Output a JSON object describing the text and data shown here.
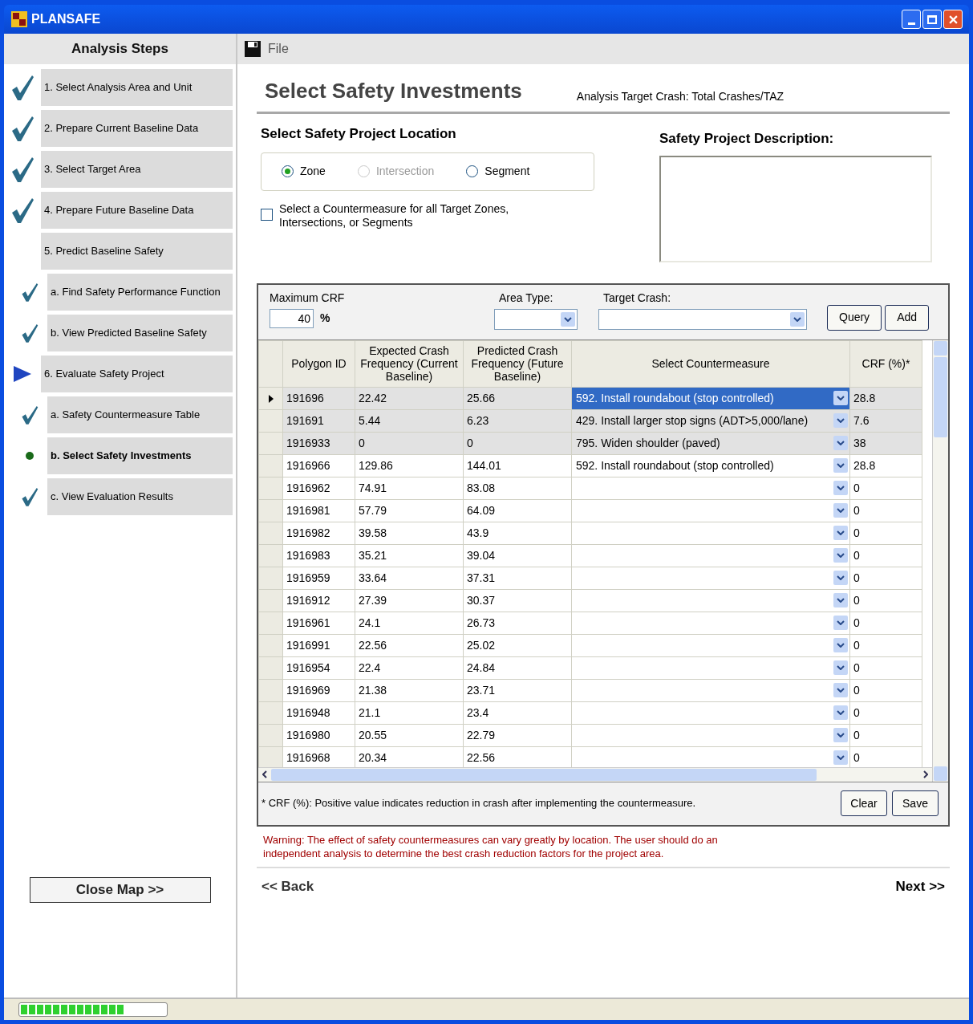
{
  "window": {
    "title": "PLANSAFE"
  },
  "sidebar": {
    "title": "Analysis Steps",
    "steps": [
      {
        "label": "1. Select Analysis Area and Unit",
        "kind": "done"
      },
      {
        "label": "2. Prepare Current Baseline Data",
        "kind": "done"
      },
      {
        "label": "3. Select Target Area",
        "kind": "done"
      },
      {
        "label": "4. Prepare Future Baseline Data",
        "kind": "done"
      },
      {
        "label": "5. Predict Baseline Safety",
        "kind": "plain",
        "children": [
          {
            "label": "a. Find Safety Performance Function",
            "kind": "done"
          },
          {
            "label": "b. View Predicted Baseline Safety",
            "kind": "done"
          }
        ]
      },
      {
        "label": "6. Evaluate Safety Project",
        "kind": "current",
        "children": [
          {
            "label": "a. Safety Countermeasure Table",
            "kind": "done"
          },
          {
            "label": "b. Select Safety Investments",
            "kind": "active"
          },
          {
            "label": "c. View Evaluation Results",
            "kind": "done"
          }
        ]
      }
    ],
    "close_button": "Close Map >>"
  },
  "menu": {
    "file": "File"
  },
  "page": {
    "title": "Select Safety Investments",
    "target_crash": "Analysis Target Crash: Total Crashes/TAZ",
    "location_title": "Select Safety Project Location",
    "location_options": [
      {
        "label": "Zone",
        "selected": true,
        "disabled": false
      },
      {
        "label": "Intersection",
        "selected": false,
        "disabled": true
      },
      {
        "label": "Segment",
        "selected": false,
        "disabled": false
      }
    ],
    "all_targets": {
      "label": "Select a Countermeasure for all Target Zones, Intersections, or Segments",
      "checked": false
    },
    "description_title": "Safety Project Description:"
  },
  "filters": {
    "max_crf_label": "Maximum CRF",
    "max_crf": "40",
    "percent": "%",
    "area_type_label": "Area Type:",
    "target_crash_label": "Target Crash:",
    "buttons": [
      "Query",
      "Add"
    ]
  },
  "table": {
    "columns": [
      "Polygon ID",
      "Expected Crash Frequency (Current Baseline)",
      "Predicted Crash Frequency (Future Baseline)",
      "Select Countermeasure",
      "CRF (%)*"
    ],
    "rows": [
      {
        "cells": [
          "191696",
          "22.42",
          "25.66",
          "592. Install roundabout (stop controlled)",
          "28.8"
        ],
        "selected": true,
        "current": true
      },
      {
        "cells": [
          "191691",
          "5.44",
          "6.23",
          "429. Install larger stop signs (ADT>5,000/lane)",
          "7.6"
        ],
        "selected": true,
        "current": false
      },
      {
        "cells": [
          "1916933",
          "0",
          "0",
          "795. Widen shoulder (paved)",
          "38"
        ],
        "selected": true,
        "current": false
      },
      {
        "cells": [
          "1916966",
          "129.86",
          "144.01",
          "592. Install roundabout (stop controlled)",
          "28.8"
        ],
        "selected": false,
        "current": false
      },
      {
        "cells": [
          "1916962",
          "74.91",
          "83.08",
          "",
          "0"
        ],
        "selected": false,
        "current": false
      },
      {
        "cells": [
          "1916981",
          "57.79",
          "64.09",
          "",
          "0"
        ],
        "selected": false,
        "current": false
      },
      {
        "cells": [
          "1916982",
          "39.58",
          "43.9",
          "",
          "0"
        ],
        "selected": false,
        "current": false
      },
      {
        "cells": [
          "1916983",
          "35.21",
          "39.04",
          "",
          "0"
        ],
        "selected": false,
        "current": false
      },
      {
        "cells": [
          "1916959",
          "33.64",
          "37.31",
          "",
          "0"
        ],
        "selected": false,
        "current": false
      },
      {
        "cells": [
          "1916912",
          "27.39",
          "30.37",
          "",
          "0"
        ],
        "selected": false,
        "current": false
      },
      {
        "cells": [
          "1916961",
          "24.1",
          "26.73",
          "",
          "0"
        ],
        "selected": false,
        "current": false
      },
      {
        "cells": [
          "1916991",
          "22.56",
          "25.02",
          "",
          "0"
        ],
        "selected": false,
        "current": false
      },
      {
        "cells": [
          "1916954",
          "22.4",
          "24.84",
          "",
          "0"
        ],
        "selected": false,
        "current": false
      },
      {
        "cells": [
          "1916969",
          "21.38",
          "23.71",
          "",
          "0"
        ],
        "selected": false,
        "current": false
      },
      {
        "cells": [
          "1916948",
          "21.1",
          "23.4",
          "",
          "0"
        ],
        "selected": false,
        "current": false
      },
      {
        "cells": [
          "1916980",
          "20.55",
          "22.79",
          "",
          "0"
        ],
        "selected": false,
        "current": false
      },
      {
        "cells": [
          "1916968",
          "20.34",
          "22.56",
          "",
          "0"
        ],
        "selected": false,
        "current": false
      }
    ],
    "footnote": "* CRF (%): Positive value indicates reduction in crash after implementing the countermeasure.",
    "buttons": [
      "Clear",
      "Save"
    ]
  },
  "warning": "Warning: The effect of safety countermeasures can vary greatly by location. The user should do an independent analysis to determine the best crash reduction factors for the project area.",
  "nav": {
    "back": "<< Back",
    "next": "Next >>"
  },
  "status_bar": {
    "progress": {
      "level": 0.72
    }
  }
}
